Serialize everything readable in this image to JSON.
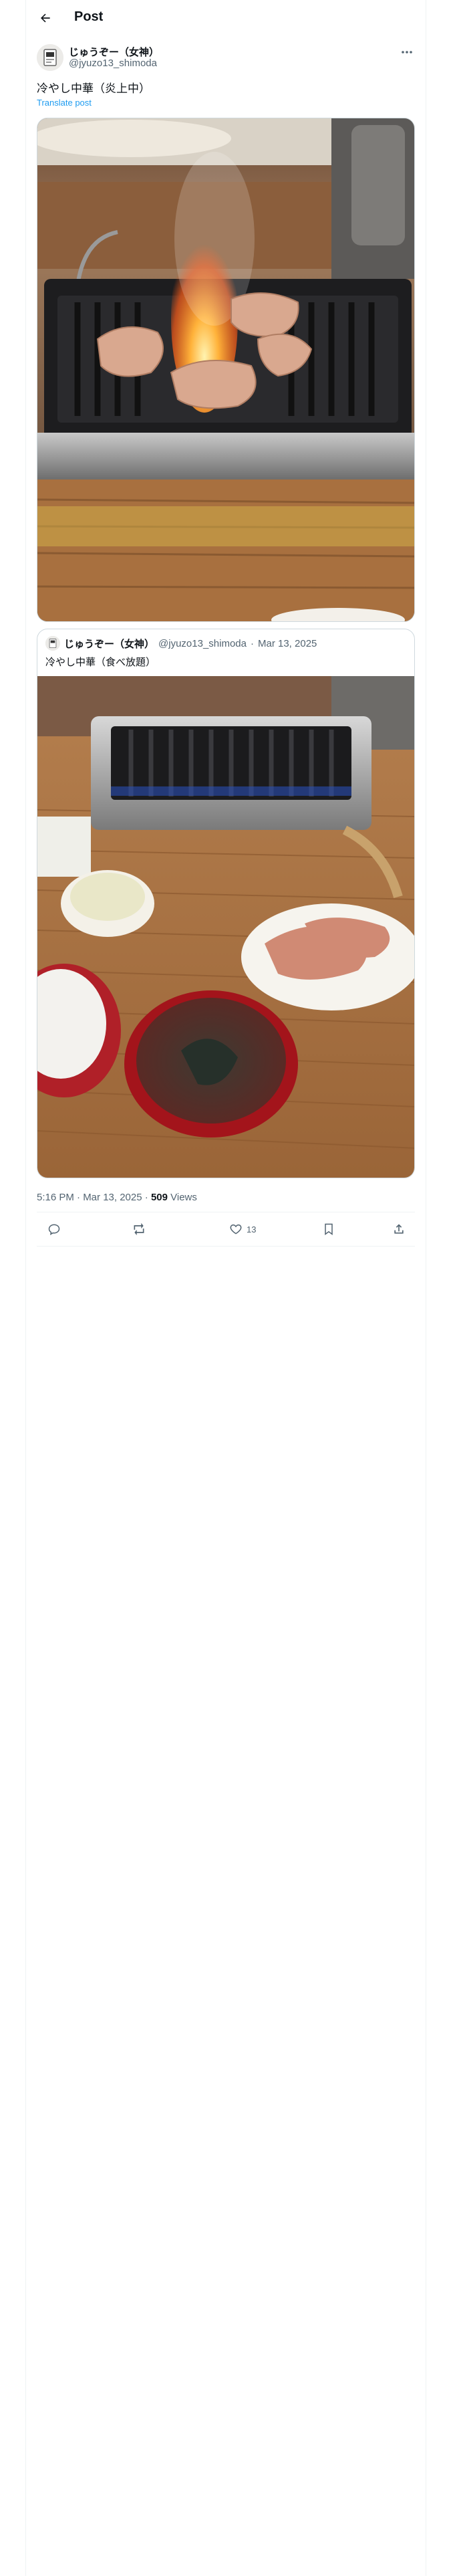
{
  "header": {
    "title": "Post"
  },
  "post": {
    "author_name": "じゅうぞー（女神）",
    "author_handle": "@jyuzo13_shimoda",
    "text": "冷やし中華（炎上中）",
    "translate_label": "Translate post",
    "time": "5:16 PM · Mar 13, 2025",
    "meta_separator": " · ",
    "views_count": "509",
    "views_label": "Views"
  },
  "quoted": {
    "author_name": "じゅうぞー（女神）",
    "author_handle": "@jyuzo13_shimoda",
    "separator": "·",
    "date": "Mar 13, 2025",
    "text": "冷やし中華（食べ放題）"
  },
  "actions": {
    "likes": "13"
  },
  "icons": [
    "back-arrow-icon",
    "more-icon",
    "reply-icon",
    "repost-icon",
    "like-icon",
    "bookmark-icon",
    "share-icon"
  ]
}
